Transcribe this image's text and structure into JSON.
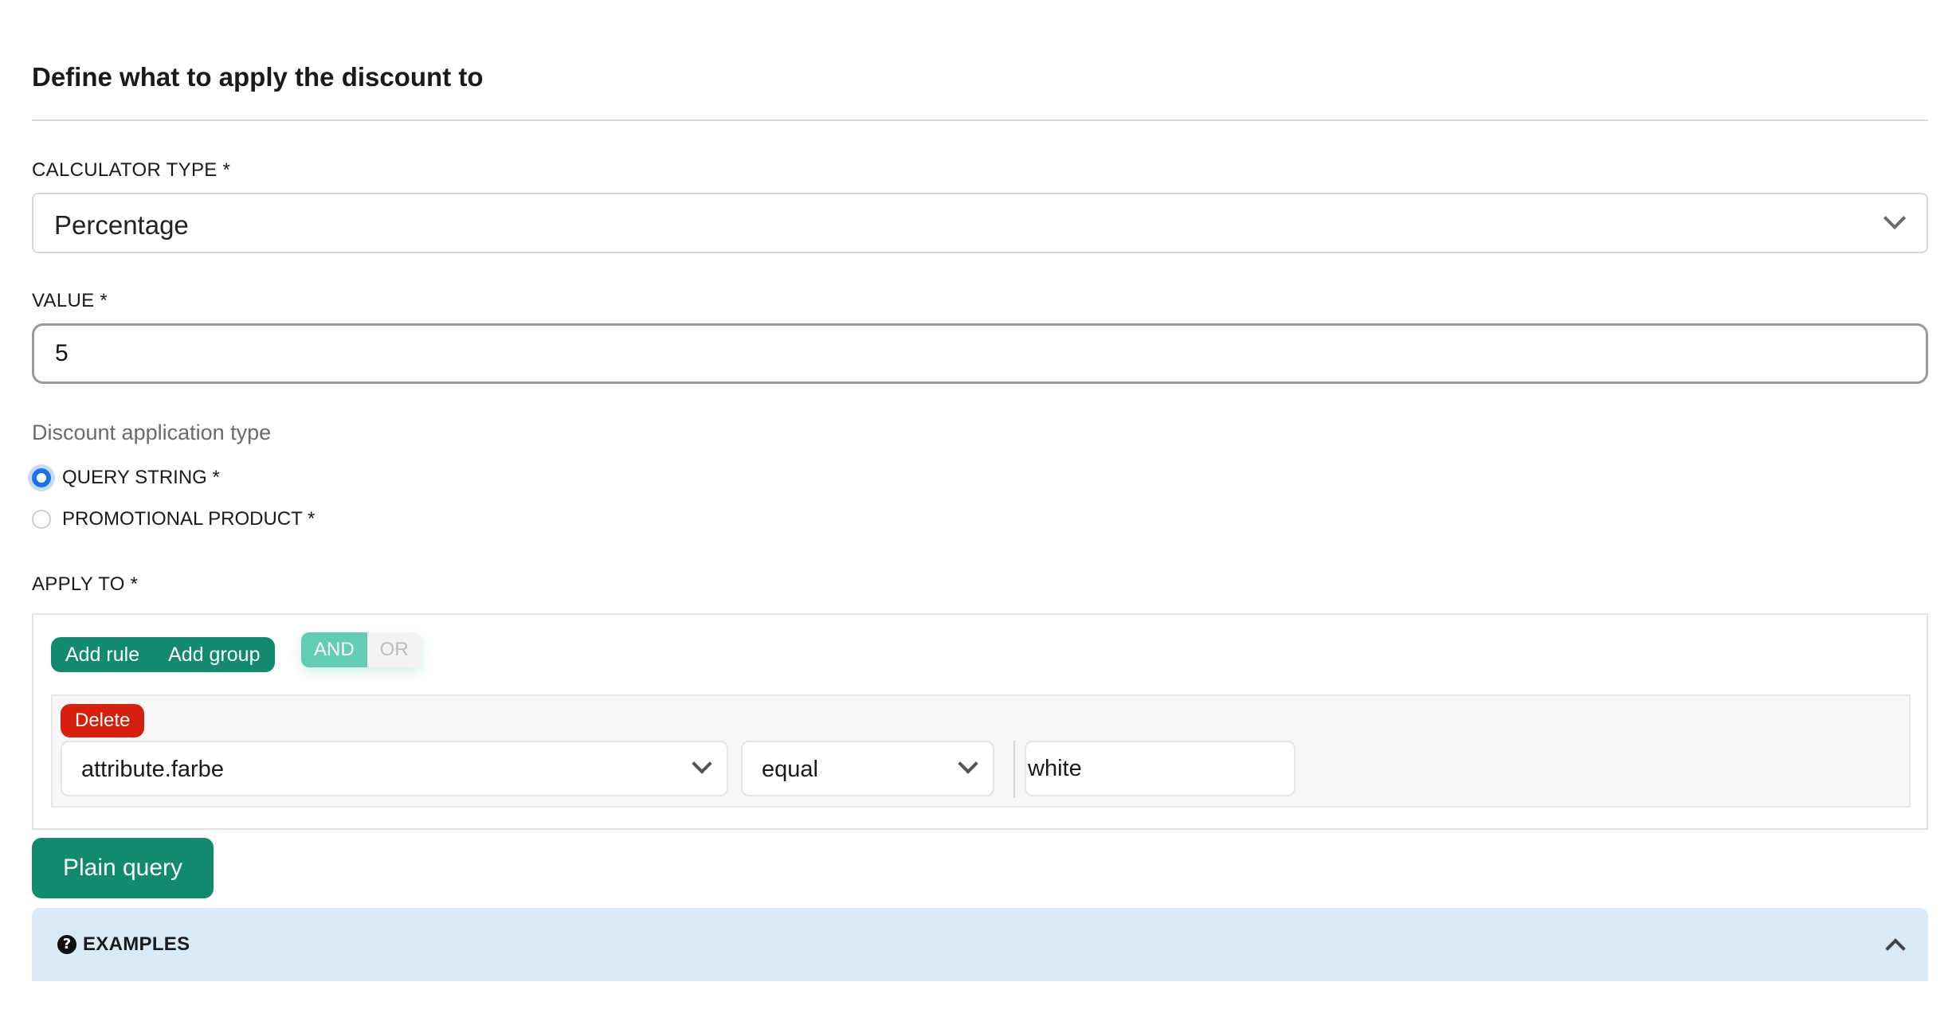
{
  "section": {
    "title": "Define what to apply the discount to"
  },
  "calculator": {
    "label": "CALCULATOR TYPE *",
    "selected": "Percentage"
  },
  "value": {
    "label": "VALUE *",
    "current": "5"
  },
  "application_type": {
    "label": "Discount application type",
    "options": [
      {
        "label": "QUERY STRING *",
        "checked": true
      },
      {
        "label": "PROMOTIONAL PRODUCT *",
        "checked": false
      }
    ]
  },
  "apply_to": {
    "label": "APPLY TO *",
    "buttons": {
      "add_rule": "Add rule",
      "add_group": "Add group"
    },
    "conjunctions": {
      "and": "AND",
      "or": "OR",
      "active": "AND"
    },
    "rule": {
      "delete_label": "Delete",
      "field": "attribute.farbe",
      "operator": "equal",
      "value": "white"
    }
  },
  "plain_query": {
    "label": "Plain query"
  },
  "examples": {
    "label": "EXAMPLES",
    "icon": "question-circle-icon"
  },
  "colors": {
    "accent": "#128a6d",
    "and_active": "#62cdb2",
    "delete": "#d61f0e",
    "radio": "#1a73e8",
    "examples_bg": "#d9ecf6"
  }
}
